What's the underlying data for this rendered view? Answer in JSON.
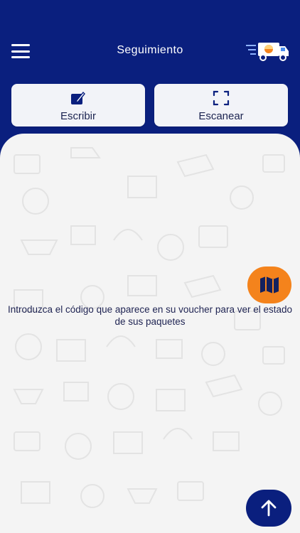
{
  "header": {
    "title": "Seguimiento",
    "menu_icon": "hamburger-menu-icon",
    "logo_icon": "delivery-truck-icon"
  },
  "actions": [
    {
      "label": "Escribir",
      "icon": "edit-icon"
    },
    {
      "label": "Escanear",
      "icon": "scan-frame-icon"
    }
  ],
  "content": {
    "instruction": "Introduzca el código que aparece en su voucher para ver el estado de sus paquetes",
    "map_button_icon": "map-icon",
    "scroll_top_icon": "arrow-up-icon"
  },
  "colors": {
    "primary": "#0a1f7e",
    "accent": "#f4831c",
    "surface": "#f4f4f4",
    "card": "#f2f3f8"
  }
}
